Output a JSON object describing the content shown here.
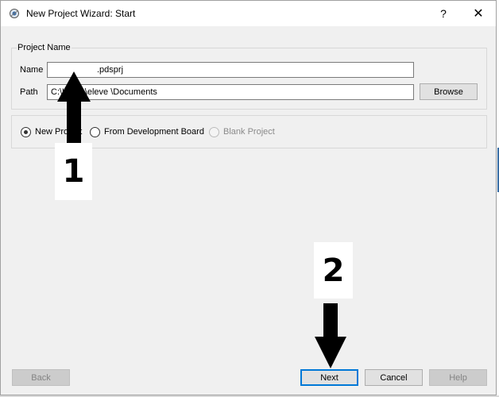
{
  "window": {
    "title": "New Project Wizard: Start",
    "help_label": "?",
    "close_label": "✕",
    "app_icon": "proteus-app-icon"
  },
  "project_name": {
    "group_label": "Project Name",
    "name_label": "Name",
    "name_value": ".pdsprj",
    "path_label": "Path",
    "path_value": "C:\\Users\\eleve \\Documents",
    "browse_label": "Browse"
  },
  "project_type": {
    "options": [
      {
        "label": "New Project",
        "checked": true,
        "enabled": true
      },
      {
        "label": "From Development Board",
        "checked": false,
        "enabled": true
      },
      {
        "label": "Blank Project",
        "checked": false,
        "enabled": false
      }
    ]
  },
  "footer": {
    "back_label": "Back",
    "next_label": "Next",
    "cancel_label": "Cancel",
    "help_label": "Help"
  },
  "annotations": {
    "step1": "1",
    "step2": "2"
  }
}
